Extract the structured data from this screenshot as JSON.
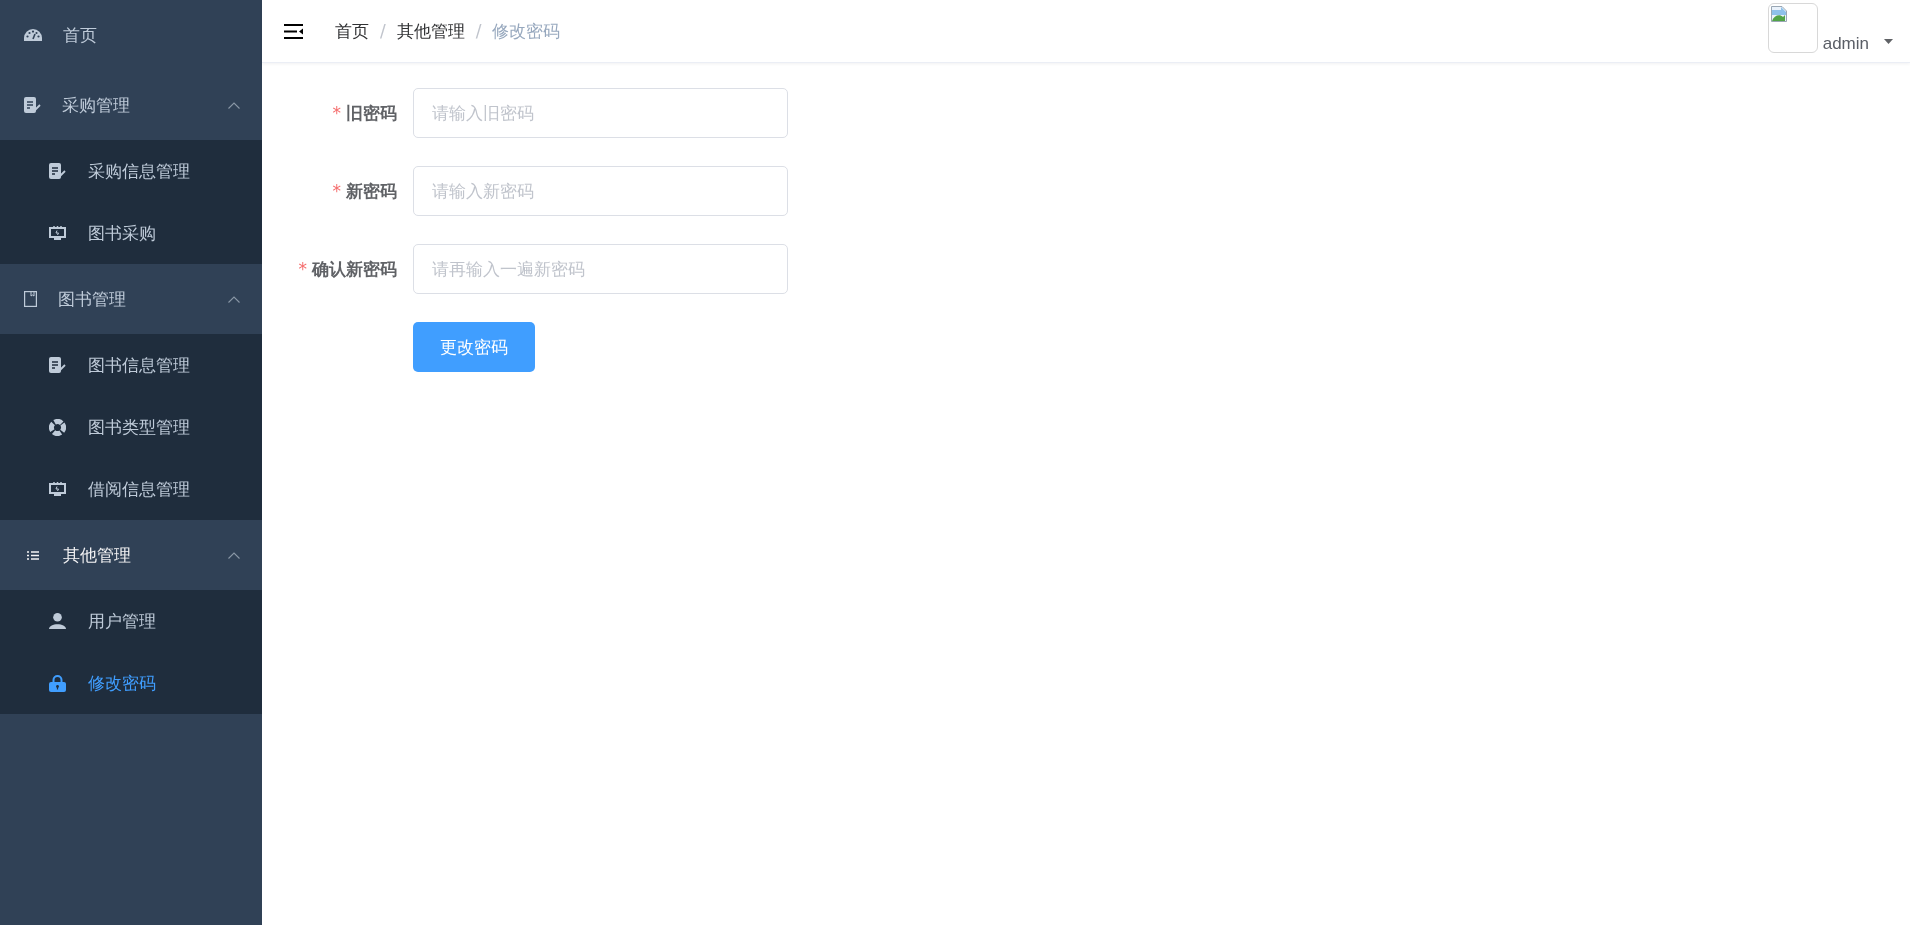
{
  "sidebar": {
    "items": [
      {
        "kind": "link",
        "label": "首页",
        "selected": false
      },
      {
        "kind": "group",
        "label": "采购管理",
        "expanded": true,
        "active": false,
        "children": [
          {
            "label": "采购信息管理",
            "selected": false
          },
          {
            "label": "图书采购",
            "selected": false
          }
        ]
      },
      {
        "kind": "group",
        "label": "图书管理",
        "expanded": true,
        "active": false,
        "children": [
          {
            "label": "图书信息管理",
            "selected": false
          },
          {
            "label": "图书类型管理",
            "selected": false
          },
          {
            "label": "借阅信息管理",
            "selected": false
          }
        ]
      },
      {
        "kind": "group",
        "label": "其他管理",
        "expanded": true,
        "active": true,
        "children": [
          {
            "label": "用户管理",
            "selected": false
          },
          {
            "label": "修改密码",
            "selected": true
          }
        ]
      }
    ]
  },
  "header": {
    "breadcrumb": [
      {
        "label": "首页",
        "current": false,
        "separator": "/"
      },
      {
        "label": "其他管理",
        "current": false,
        "separator": "/"
      },
      {
        "label": "修改密码",
        "current": true
      }
    ],
    "user": {
      "name": "admin"
    }
  },
  "form": {
    "fields": [
      {
        "label": "旧密码",
        "required_mark": "*",
        "placeholder": "请输入旧密码"
      },
      {
        "label": "新密码",
        "required_mark": "*",
        "placeholder": "请输入新密码"
      },
      {
        "label": "确认新密码",
        "required_mark": "*",
        "placeholder": "请再输入一遍新密码"
      }
    ],
    "submit": "更改密码"
  }
}
